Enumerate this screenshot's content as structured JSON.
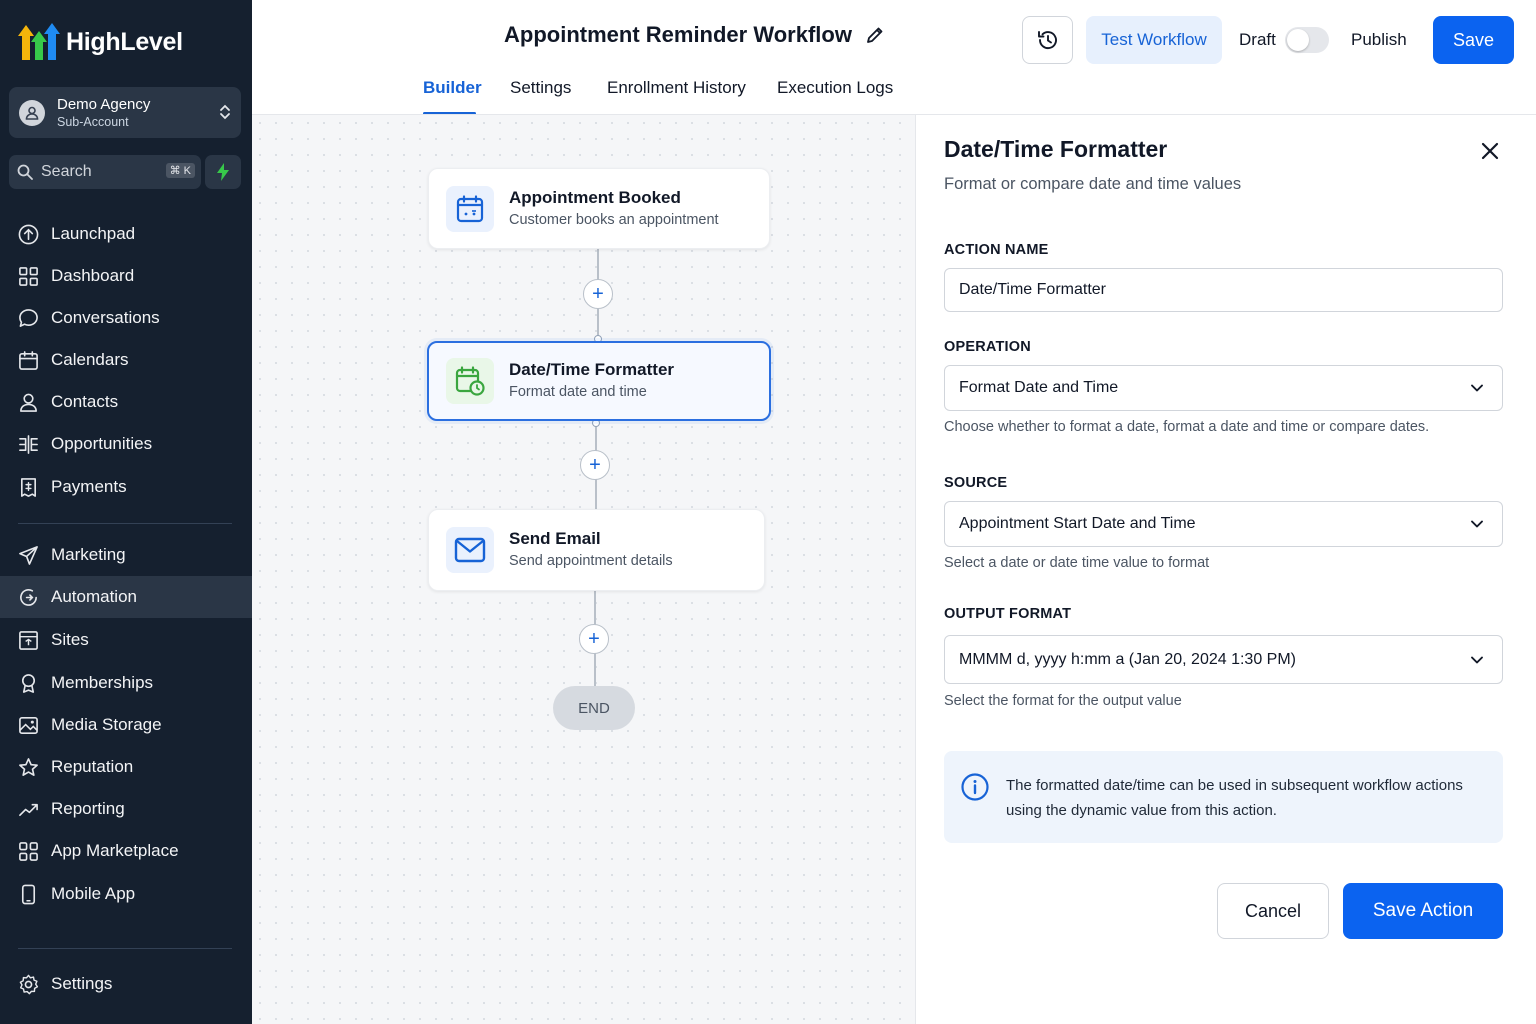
{
  "brand": {
    "name": "HighLevel"
  },
  "account": {
    "name": "Demo Agency",
    "type": "Sub-Account"
  },
  "search": {
    "label": "Search",
    "shortcut": "⌘ K"
  },
  "nav": {
    "items": [
      {
        "label": "Launchpad",
        "icon": "launchpad-icon"
      },
      {
        "label": "Dashboard",
        "icon": "dashboard-icon"
      },
      {
        "label": "Conversations",
        "icon": "chat-bubble-icon"
      },
      {
        "label": "Calendars",
        "icon": "calendar-icon"
      },
      {
        "label": "Contacts",
        "icon": "contacts-icon"
      },
      {
        "label": "Opportunities",
        "icon": "opportunities-icon"
      },
      {
        "label": "Payments",
        "icon": "receipt-icon"
      },
      {
        "label": "Marketing",
        "icon": "send-icon"
      },
      {
        "label": "Automation",
        "icon": "automation-icon"
      },
      {
        "label": "Sites",
        "icon": "sites-icon"
      },
      {
        "label": "Memberships",
        "icon": "award-icon"
      },
      {
        "label": "Media Storage",
        "icon": "image-folder-icon"
      },
      {
        "label": "Reputation",
        "icon": "star-icon"
      },
      {
        "label": "Reporting",
        "icon": "trend-icon"
      },
      {
        "label": "App Marketplace",
        "icon": "grid-icon"
      },
      {
        "label": "Mobile App",
        "icon": "phone-icon"
      }
    ],
    "active": "Automation",
    "settings": "Settings"
  },
  "header": {
    "title": "Appointment Reminder Workflow",
    "test_label": "Test Workflow",
    "draft_label": "Draft",
    "publish_label": "Publish",
    "save_label": "Save",
    "tabs": [
      "Builder",
      "Settings",
      "Enrollment History",
      "Execution Logs"
    ],
    "active_tab": "Builder"
  },
  "workflow": {
    "nodes": [
      {
        "title": "Appointment Booked",
        "subtitle": "Customer books an appointment"
      },
      {
        "title": "Date/Time Formatter",
        "subtitle": "Format date and time"
      },
      {
        "title": "Send Email",
        "subtitle": "Send appointment details"
      }
    ],
    "end_label": "END"
  },
  "panel": {
    "title": "Date/Time Formatter",
    "subtitle": "Format or compare date and time values",
    "action_name_label": "ACTION NAME",
    "action_name_value": "Date/Time Formatter",
    "operation_label": "OPERATION",
    "operation_value": "Format Date and Time",
    "operation_help": "Choose whether to format a date, format a date and time or compare dates.",
    "source_label": "SOURCE",
    "source_value": "Appointment Start Date and Time",
    "source_help": "Select a date or date time value to format",
    "output_label": "OUTPUT FORMAT",
    "output_value": "MMMM d, yyyy h:mm a (Jan 20, 2024 1:30 PM)",
    "output_help": "Select the format for the output value",
    "info_text": "The formatted date/time can be used in subsequent workflow actions using the dynamic value from this action.",
    "cancel_label": "Cancel",
    "save_action_label": "Save Action"
  },
  "colors": {
    "primary": "#0b63f0",
    "sidebar_bg": "#15202f",
    "active_tab": "#1763d6"
  }
}
